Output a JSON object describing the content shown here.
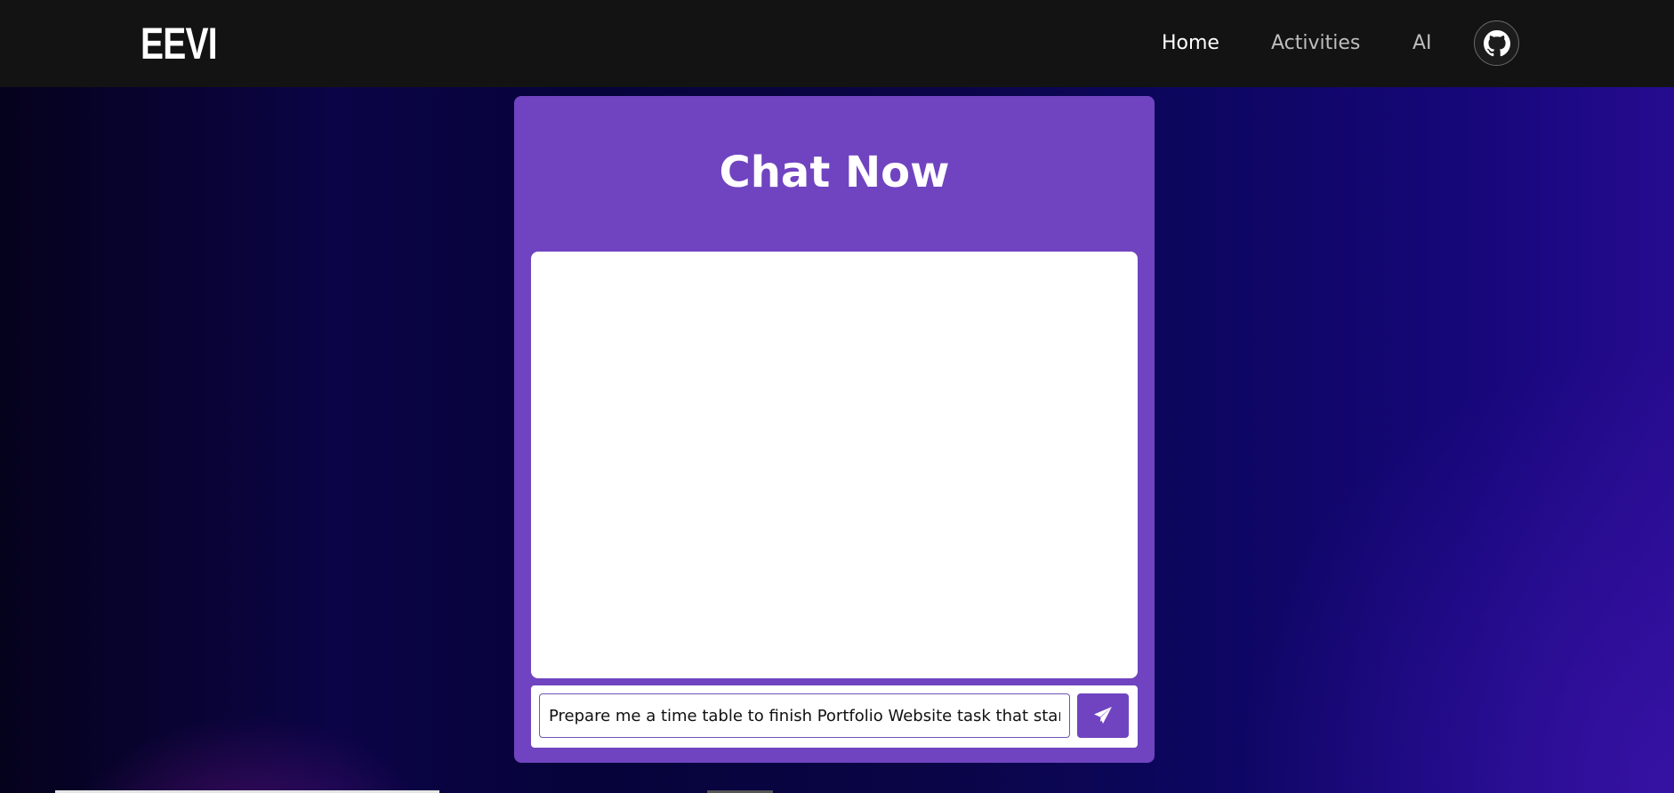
{
  "brand": {
    "logo_text": "EEVI"
  },
  "nav": {
    "links": [
      {
        "label": "Home",
        "active": true
      },
      {
        "label": "Activities",
        "active": false
      },
      {
        "label": "AI",
        "active": false
      }
    ],
    "github_icon": "github-icon"
  },
  "chat": {
    "title": "Chat Now",
    "messages": [],
    "input_value": "Prepare me a time table to finish Portfolio Website task that starts",
    "send_icon": "paper-plane-icon"
  },
  "colors": {
    "navbar": "#131313",
    "card": "#7044c0",
    "accent": "#7044c0",
    "page_background": "#0b0446"
  }
}
